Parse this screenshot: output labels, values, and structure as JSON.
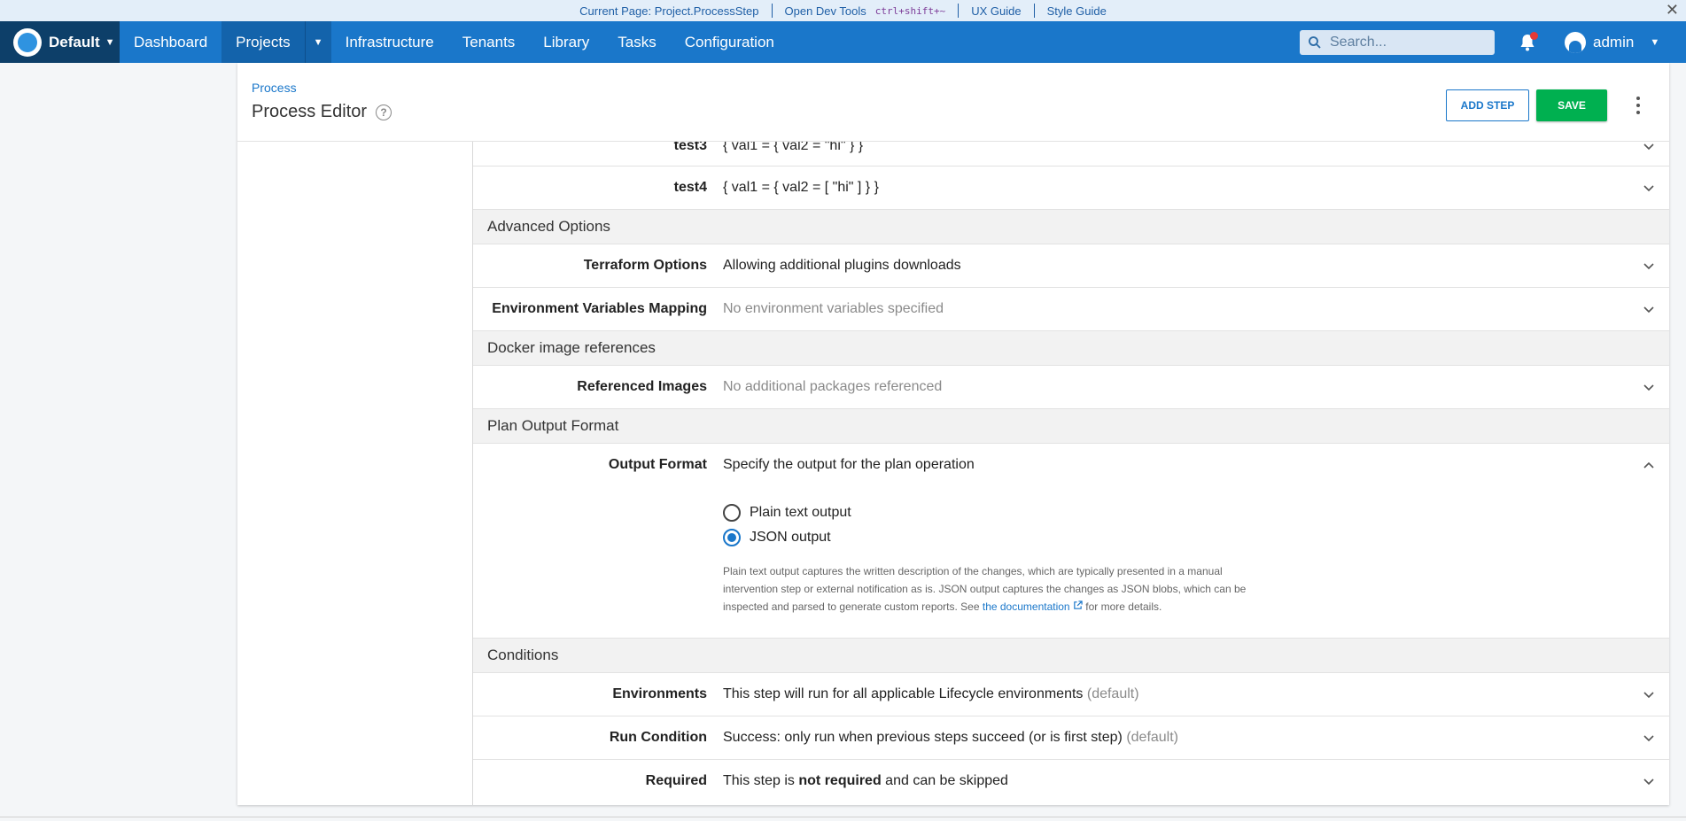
{
  "devbar": {
    "current_page": "Current Page: Project.ProcessStep",
    "devtools": "Open Dev Tools",
    "devtools_shortcut": "ctrl+shift+~",
    "ux_guide": "UX Guide",
    "style_guide": "Style Guide",
    "close": "✕"
  },
  "nav": {
    "space_name": "Default",
    "items": [
      "Dashboard",
      "Projects",
      "Infrastructure",
      "Tenants",
      "Library",
      "Tasks",
      "Configuration"
    ],
    "search_placeholder": "Search...",
    "user": "admin"
  },
  "header": {
    "breadcrumb": "Process",
    "title": "Process Editor",
    "add_step": "ADD STEP",
    "save": "SAVE"
  },
  "rows_top": [
    {
      "label": "test3",
      "value": "{ val1 = { val2 = \"hi\" } }"
    },
    {
      "label": "test4",
      "value": "{ val1 = { val2 = [ \"hi\" ] } }"
    }
  ],
  "advanced": {
    "heading": "Advanced Options",
    "terraform_label": "Terraform Options",
    "terraform_value": "Allowing additional plugins downloads",
    "env_label": "Environment Variables Mapping",
    "env_value": "No environment variables specified"
  },
  "docker": {
    "heading": "Docker image references",
    "images_label": "Referenced Images",
    "images_value": "No additional packages referenced"
  },
  "plan": {
    "heading": "Plan Output Format",
    "output_label": "Output Format",
    "output_value": "Specify the output for the plan operation",
    "options": [
      "Plain text output",
      "JSON output"
    ],
    "selected": "JSON output",
    "note_text": "Plain text output captures the written description of the changes, which are typically presented in a manual intervention step or external notification as is. JSON output captures the changes as JSON blobs, which can be inspected and parsed to generate custom reports. See",
    "note_link": "the documentation",
    "note_end": "for more details."
  },
  "conditions": {
    "heading": "Conditions",
    "env_label": "Environments",
    "env_value": "This step will run for all applicable Lifecycle environments",
    "env_default": "(default)",
    "run_label": "Run Condition",
    "run_value": "Success: only run when previous steps succeed (or is first step)",
    "run_default": "(default)",
    "req_label": "Required",
    "req_pre": "This step is",
    "req_bold": "not required",
    "req_post": "and can be skipped"
  }
}
